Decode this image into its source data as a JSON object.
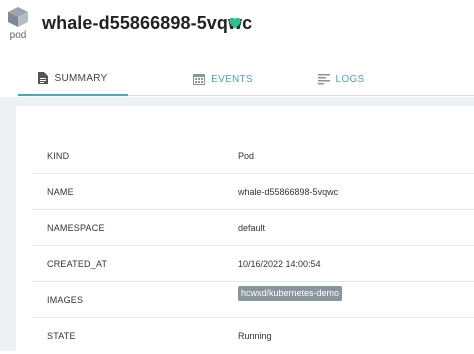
{
  "header": {
    "type_label": "pod",
    "title": "whale-d55866898-5vqwc",
    "status_icon": "heart-icon",
    "status_color": "#2fbf8f"
  },
  "tabs": [
    {
      "label": "SUMMARY",
      "icon": "document-icon",
      "active": true
    },
    {
      "label": "EVENTS",
      "icon": "calendar-icon",
      "active": false
    },
    {
      "label": "LOGS",
      "icon": "lines-icon",
      "active": false
    }
  ],
  "accent_color": "#4aa6b8",
  "summary": {
    "rows": [
      {
        "key": "KIND",
        "value": "Pod"
      },
      {
        "key": "NAME",
        "value": "whale-d55866898-5vqwc"
      },
      {
        "key": "NAMESPACE",
        "value": "default"
      },
      {
        "key": "CREATED_AT",
        "value": "10/16/2022 14:00:54"
      },
      {
        "key": "IMAGES",
        "badge": "hcwxd/kubernetes-demo"
      },
      {
        "key": "STATE",
        "value": "Running"
      }
    ]
  }
}
